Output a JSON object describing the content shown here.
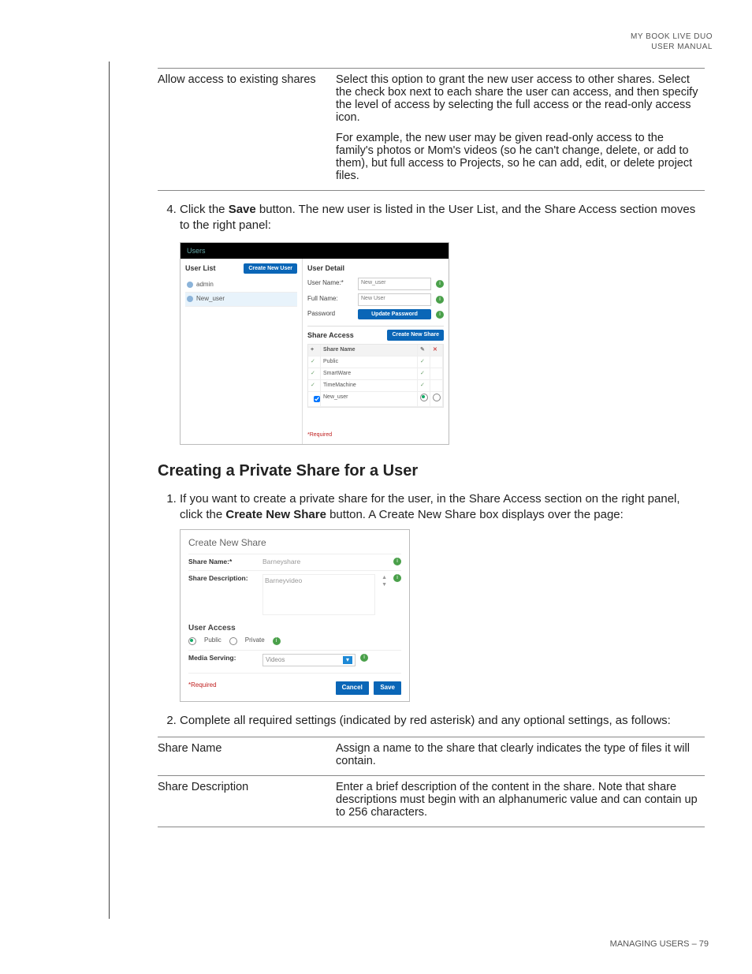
{
  "header": {
    "line1": "MY BOOK LIVE DUO",
    "line2": "USER MANUAL"
  },
  "table1": {
    "term": "Allow access to existing shares",
    "desc1": "Select this option to grant the new user access to other shares. Select the check box next to each share the user can access, and then specify the level of access by selecting the full access or the read-only access icon.",
    "desc2": "For example, the new user may be given read-only access to the family's photos or Mom's videos (so he can't change, delete, or add to them), but full access to Projects, so he can add, edit, or delete project files."
  },
  "step4": {
    "pre": "Click the ",
    "bold": "Save",
    "post": " button. The new user is listed in the User List, and the Share Access section moves to the right panel:"
  },
  "shot1": {
    "tab": "Users",
    "userlist_title": "User List",
    "create_user_btn": "Create New User",
    "users": [
      "admin",
      "New_user"
    ],
    "detail_title": "User Detail",
    "fields": {
      "username_lab": "User Name:*",
      "username_val": "New_user",
      "fullname_lab": "Full Name:",
      "fullname_val": "New User",
      "password_lab": "Password",
      "password_btn": "Update Password"
    },
    "share_access": "Share Access",
    "create_share_btn": "Create New Share",
    "cols": {
      "name": "Share Name"
    },
    "rows": [
      "Public",
      "SmartWare",
      "TimeMachine",
      "New_user"
    ],
    "required": "*Required"
  },
  "section_title": "Creating a Private Share for a User",
  "step_cps1": {
    "pre": "If you want to create a private share for the user, in the Share Access section on the right panel, click the ",
    "bold": "Create New Share",
    "post": " button. A Create New Share box displays over the page:"
  },
  "shot2": {
    "title": "Create New Share",
    "sharename_lab": "Share Name:*",
    "sharename_val": "Barneyshare",
    "sharedesc_lab": "Share Description:",
    "sharedesc_val": "Barneyvideo",
    "useraccess_lab": "User Access",
    "public_lab": "Public",
    "private_lab": "Private",
    "media_lab": "Media Serving:",
    "media_val": "Videos",
    "required": "*Required",
    "cancel": "Cancel",
    "save": "Save"
  },
  "step_cps2": "Complete all required settings (indicated by red asterisk) and any optional settings, as follows:",
  "table2": {
    "r1term": "Share Name",
    "r1desc": "Assign a name to the share that clearly indicates the type of files it will contain.",
    "r2term": "Share Description",
    "r2desc": "Enter a brief description of the content in the share. Note that share descriptions must begin with an alphanumeric value and can contain up to 256 characters."
  },
  "footer": "MANAGING USERS – 79"
}
